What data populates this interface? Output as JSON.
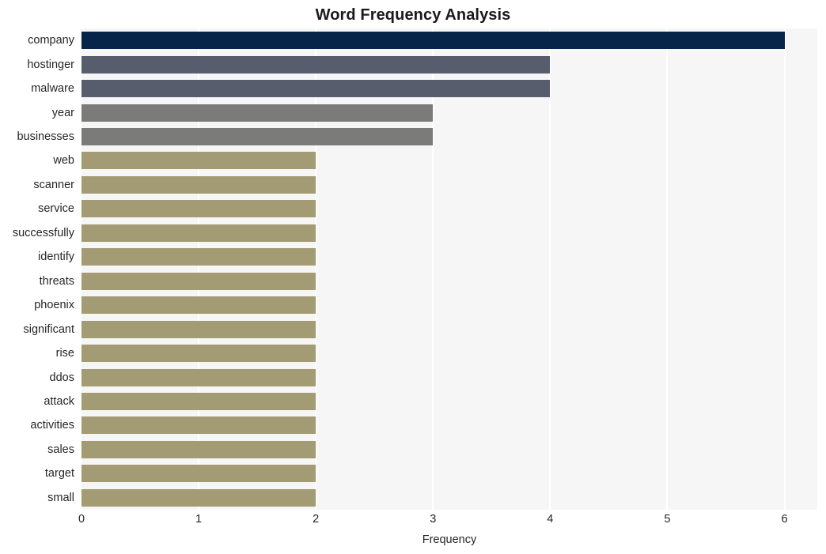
{
  "chart_data": {
    "type": "bar",
    "orientation": "horizontal",
    "title": "Word Frequency Analysis",
    "xlabel": "Frequency",
    "ylabel": "",
    "xlim": [
      0,
      6.28
    ],
    "xticks": [
      0,
      1,
      2,
      3,
      4,
      5,
      6
    ],
    "xtick_labels": [
      "0",
      "1",
      "2",
      "3",
      "4",
      "5",
      "6"
    ],
    "grid": "vertical-white-on-light-gray",
    "legend": "none",
    "categories": [
      "company",
      "hostinger",
      "malware",
      "year",
      "businesses",
      "web",
      "scanner",
      "service",
      "successfully",
      "identify",
      "threats",
      "phoenix",
      "significant",
      "rise",
      "ddos",
      "attack",
      "activities",
      "sales",
      "target",
      "small"
    ],
    "values": [
      6,
      4,
      4,
      3,
      3,
      2,
      2,
      2,
      2,
      2,
      2,
      2,
      2,
      2,
      2,
      2,
      2,
      2,
      2,
      2
    ],
    "bar_colors": [
      "#062549",
      "#575d6d",
      "#575d6d",
      "#7b7b79",
      "#7b7b79",
      "#a39b73",
      "#a39b73",
      "#a39b73",
      "#a39b73",
      "#a39b73",
      "#a39b73",
      "#a39b73",
      "#a39b73",
      "#a39b73",
      "#a39b73",
      "#a39b73",
      "#a39b73",
      "#a39b73",
      "#a39b73",
      "#a39b73"
    ],
    "plot_background": "#f6f6f6",
    "figure_background": "#ffffff",
    "gridline_color": "#ffffff",
    "tick_label_color": "#262626",
    "title_color": "#1a1a1a"
  }
}
